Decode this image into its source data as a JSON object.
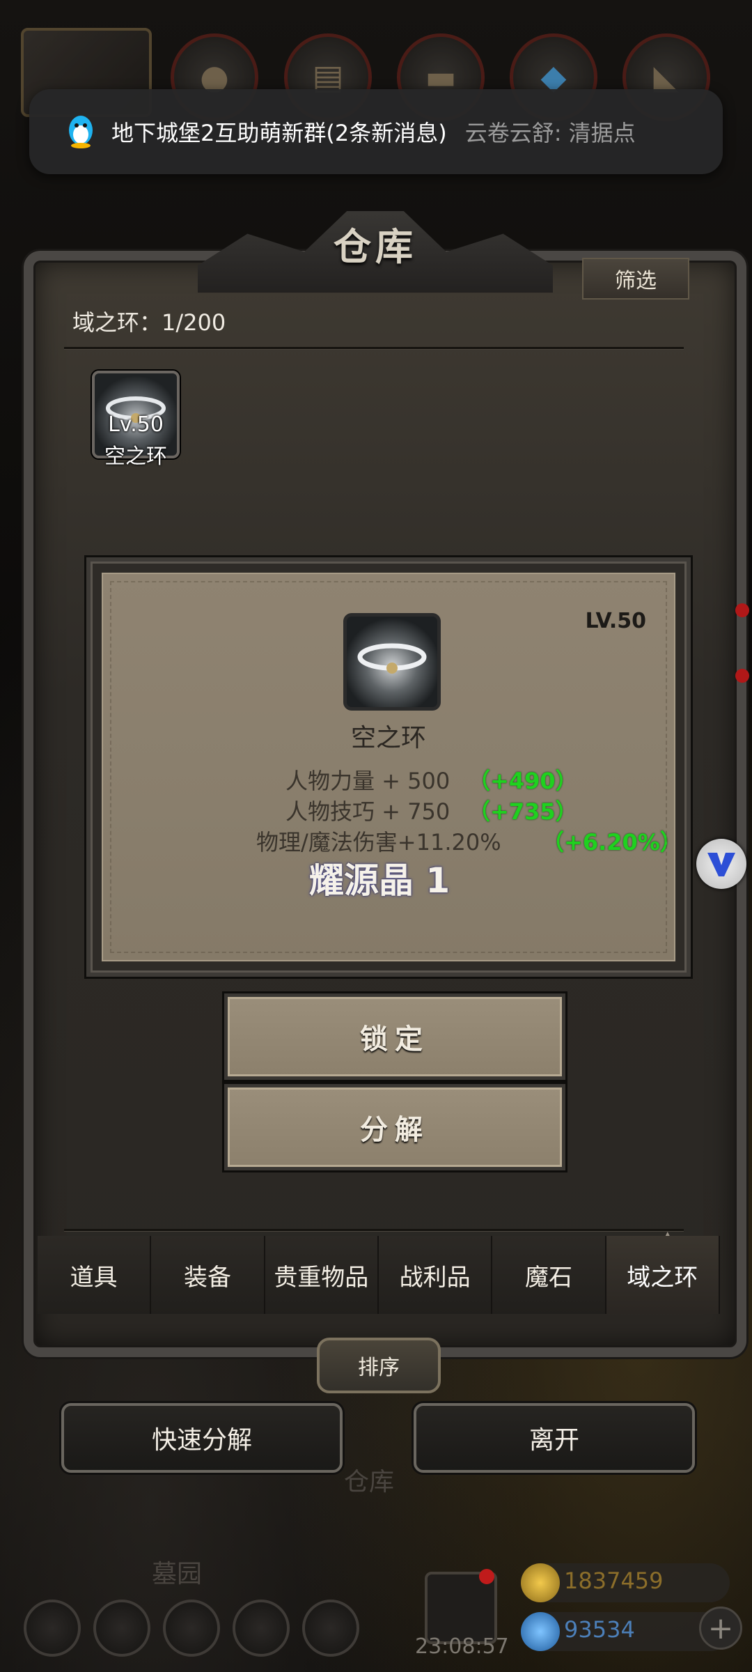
{
  "notification": {
    "title": "地下城堡2互助萌新群(2条新消息)",
    "message": "云卷云舒: 清据点"
  },
  "panel": {
    "title": "仓库",
    "filter_label": "筛选",
    "count_label": "域之环：1/200"
  },
  "items": [
    {
      "level": "Lv.50",
      "name": "空之环"
    }
  ],
  "detail": {
    "level": "LV.50",
    "name": "空之环",
    "stats": [
      {
        "text": "人物力量 + 500",
        "bonus": "（+490）"
      },
      {
        "text": "人物技巧 + 750",
        "bonus": "（+735）"
      },
      {
        "text": "物理/魔法伤害+11.20%",
        "bonus": "（+6.20%）"
      }
    ],
    "overlay": "耀源晶 1"
  },
  "actions": {
    "lock": "锁定",
    "decompose": "分解"
  },
  "tabs": [
    {
      "label": "道具",
      "active": false
    },
    {
      "label": "装备",
      "active": false
    },
    {
      "label": "贵重物品",
      "active": false
    },
    {
      "label": "战利品",
      "active": false
    },
    {
      "label": "魔石",
      "active": false
    },
    {
      "label": "域之环",
      "active": true
    }
  ],
  "sort_label": "排序",
  "bottom": {
    "quick_decompose": "快速分解",
    "leave": "离开",
    "bg_warehouse": "仓库",
    "bg_graveyard": "墓园",
    "gold": "1837459",
    "gems": "93534",
    "clock": "23:08:57"
  },
  "colors": {
    "bonus_green": "#1fd11f",
    "panel_brown": "#8a7f6d",
    "frame_gray": "#4a4744"
  },
  "icons": {
    "notification": "qq-penguin-icon",
    "item": "void-ring-icon"
  }
}
